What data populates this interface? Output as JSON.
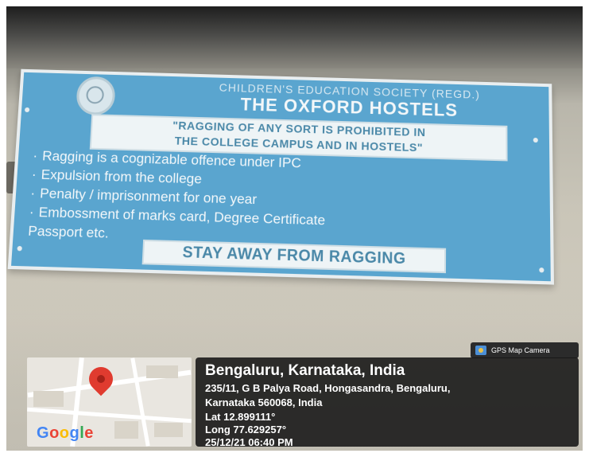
{
  "sign": {
    "society": "CHILDREN'S EDUCATION SOCIETY (REGD.)",
    "title": "THE OXFORD HOSTELS",
    "notice_line1": "\"RAGGING OF ANY SORT IS PROHIBITED IN",
    "notice_line2": "THE COLLEGE CAMPUS AND IN HOSTELS\"",
    "bullets": [
      "Ragging is a cognizable offence under IPC",
      "Expulsion from the college",
      "Penalty / imprisonment for one year",
      "Embossment of marks card, Degree Certificate"
    ],
    "bullet_continuation": "Passport etc.",
    "footer": "STAY AWAY FROM RAGGING",
    "colors": {
      "board": "#5aa5cf",
      "text": "#f4f8fa",
      "banner_text": "#4a88a8"
    }
  },
  "overlay": {
    "app_tag": "GPS Map Camera",
    "app_icon": "camera-icon",
    "map_logo": "Google",
    "location_title": "Bengaluru, Karnataka, India",
    "address_line1": "235/11, G B Palya Road, Hongasandra, Bengaluru,",
    "address_line2": "Karnataka 560068, India",
    "lat": "Lat 12.899111°",
    "long": "Long 77.629257°",
    "datetime": "25/12/21 06:40 PM",
    "pin_icon": "map-pin-icon",
    "colors": {
      "pin": "#e03b2f",
      "panel": "#161616"
    }
  }
}
